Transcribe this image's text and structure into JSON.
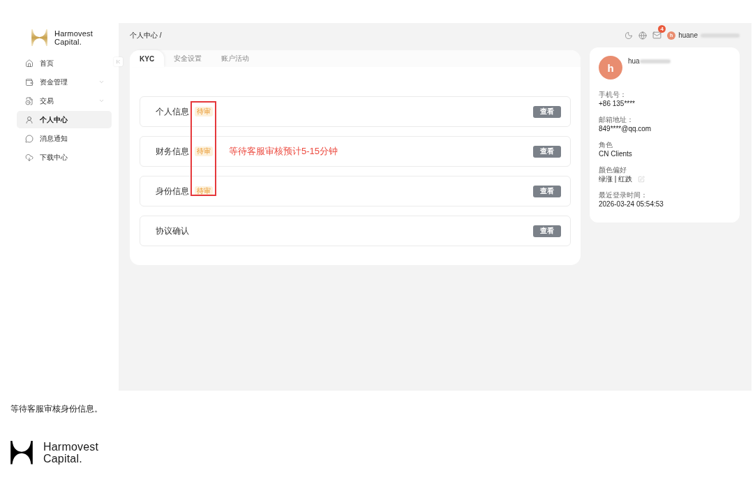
{
  "screenshot": {
    "sidebar": {
      "logo": {
        "line_1": "Harmovest",
        "line_2": "Capital."
      },
      "items": [
        {
          "label": "首页",
          "kind": "page",
          "selected": false
        },
        {
          "label": "资金管理",
          "kind": "group",
          "expanded": false,
          "selected": false
        },
        {
          "label": "交易",
          "kind": "group",
          "expanded": false,
          "selected": false
        },
        {
          "label": "个人中心",
          "kind": "page",
          "selected": true
        },
        {
          "label": "消息通知",
          "kind": "page",
          "selected": false
        },
        {
          "label": "下载中心",
          "kind": "page",
          "selected": false
        }
      ]
    },
    "top_bar": {
      "breadcrumb": "个人中心 /",
      "mail_badge": "4",
      "avatar_letter": "h",
      "user_name": "huane"
    },
    "tabs": [
      {
        "label": "KYC",
        "selected": true
      },
      {
        "label": "安全设置",
        "selected": false
      },
      {
        "label": "账户活动",
        "selected": false
      }
    ],
    "kyc_rows": [
      {
        "label": "个人信息",
        "status": "待审",
        "button": "查看"
      },
      {
        "label": "财务信息",
        "status": "待审",
        "annotation": "等待客服审核预计5-15分钟",
        "button": "查看"
      },
      {
        "label": "身份信息",
        "status": "待审",
        "button": "查看"
      },
      {
        "label": "协议确认",
        "button": "查看"
      }
    ],
    "profile": {
      "avatar_letter": "h",
      "name": "hua",
      "fields": [
        {
          "label": "手机号：",
          "value": "+86 135****"
        },
        {
          "label": "邮箱地址：",
          "value": "849****@qq.com"
        },
        {
          "label": "角色",
          "value": "CN Clients"
        },
        {
          "label": "颜色偏好",
          "value": "绿涨 | 红跌",
          "editable": true
        },
        {
          "label": "最近登录时间：",
          "value": "2026-03-24 05:54:53"
        }
      ]
    }
  },
  "caption": "等待客服审核身份信息。",
  "footer_logo": {
    "line_1": "Harmovest",
    "line_2": "Capital."
  }
}
